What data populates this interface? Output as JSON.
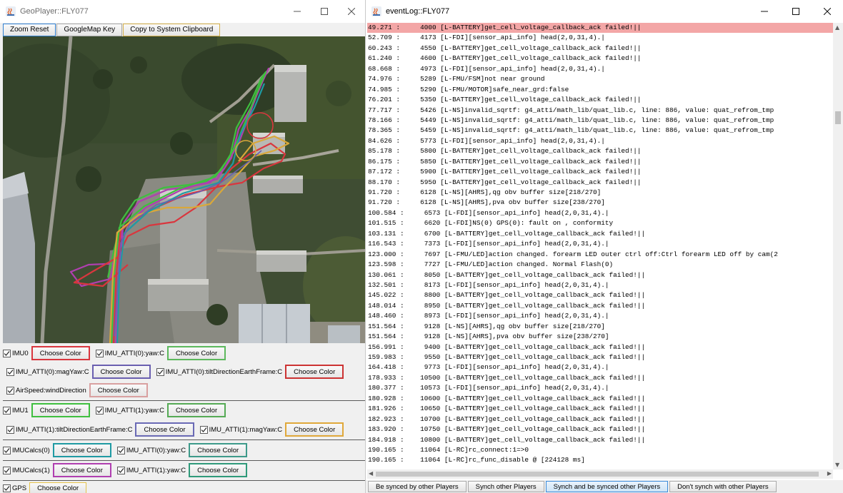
{
  "geo_window": {
    "title": "GeoPlayer::FLY077",
    "toolbar": {
      "zoom_reset": "Zoom Reset",
      "googlemap_key": "GoogleMap Key",
      "copy_clipboard": "Copy to System Clipboard"
    }
  },
  "legend": {
    "choose_color": "Choose Color",
    "items": [
      {
        "label": "IMU0",
        "color": "#d9363e"
      },
      {
        "label": "IMU_ATTI(0):yaw:C",
        "color": "#5cb85c"
      },
      {
        "label": "IMU_ATTI(0):magYaw:C",
        "color": "#6a5fb0"
      },
      {
        "label": "IMU_ATTI(0):tiltDirectionEarthFrame:C",
        "color": "#cc3333"
      },
      {
        "label": "AirSpeed:windDirection",
        "color": "#d9a0a0"
      },
      {
        "label": "IMU1",
        "color": "#3fbf3f"
      },
      {
        "label": "IMU_ATTI(1):yaw:C",
        "color": "#55aa55"
      },
      {
        "label": "IMU_ATTI(1):tiltDirectionEarthFrame:C",
        "color": "#6a6ab5"
      },
      {
        "label": "IMU_ATTI(1):magYaw:C",
        "color": "#e0a83a"
      },
      {
        "label": "IMUCalcs(0)",
        "color": "#1f9aa3"
      },
      {
        "label": "IMU_ATTI(0):yaw:C",
        "color": "#3d9a8a"
      },
      {
        "label": "IMUCalcs(1)",
        "color": "#b03fb0"
      },
      {
        "label": "IMU_ATTI(1):yaw:C",
        "color": "#2f9a7a"
      },
      {
        "label": "GPS",
        "color": "#e6c34a"
      }
    ]
  },
  "event_window": {
    "title": "eventLog::FLY077",
    "lines": [
      "49.271 :     4000 [L-BATTERY]get_cell_voltage_callback_ack failed!||",
      "52.709 :     4173 [L-FDI][sensor_api_info] head(2,0,31,4).|",
      "60.243 :     4550 [L-BATTERY]get_cell_voltage_callback_ack failed!||",
      "61.240 :     4600 [L-BATTERY]get_cell_voltage_callback_ack failed!||",
      "68.668 :     4973 [L-FDI][sensor_api_info] head(2,0,31,4).|",
      "74.976 :     5289 [L-FMU/FSM]not near ground",
      "74.985 :     5290 [L-FMU/MOTOR]safe_near_grd:false",
      "76.201 :     5350 [L-BATTERY]get_cell_voltage_callback_ack failed!||",
      "77.717 :     5426 [L-NS]invalid_sqrtf: g4_atti/math_lib/quat_lib.c, line: 886, value: quat_refrom_tmp",
      "78.166 :     5449 [L-NS]invalid_sqrtf: g4_atti/math_lib/quat_lib.c, line: 886, value: quat_refrom_tmp",
      "78.365 :     5459 [L-NS]invalid_sqrtf: g4_atti/math_lib/quat_lib.c, line: 886, value: quat_refrom_tmp",
      "84.626 :     5773 [L-FDI][sensor_api_info] head(2,0,31,4).|",
      "85.178 :     5800 [L-BATTERY]get_cell_voltage_callback_ack failed!||",
      "86.175 :     5850 [L-BATTERY]get_cell_voltage_callback_ack failed!||",
      "87.172 :     5900 [L-BATTERY]get_cell_voltage_callback_ack failed!||",
      "88.170 :     5950 [L-BATTERY]get_cell_voltage_callback_ack failed!||",
      "91.720 :     6128 [L-NS][AHRS],qg obv buffer size[218/270]",
      "91.720 :     6128 [L-NS][AHRS],pva obv buffer size[238/270]",
      "100.584 :     6573 [L-FDI][sensor_api_info] head(2,0,31,4).|",
      "101.515 :     6620 [L-FDI]NS(0) GPS(0): fault on , conformity",
      "103.131 :     6700 [L-BATTERY]get_cell_voltage_callback_ack failed!||",
      "116.543 :     7373 [L-FDI][sensor_api_info] head(2,0,31,4).|",
      "123.000 :     7697 [L-FMU/LED]action changed. forearm LED outer ctrl off:Ctrl forearm LED off by cam(2",
      "123.598 :     7727 [L-FMU/LED]action changed. Normal Flash(0)",
      "130.061 :     8050 [L-BATTERY]get_cell_voltage_callback_ack failed!||",
      "132.501 :     8173 [L-FDI][sensor_api_info] head(2,0,31,4).|",
      "145.022 :     8800 [L-BATTERY]get_cell_voltage_callback_ack failed!||",
      "148.014 :     8950 [L-BATTERY]get_cell_voltage_callback_ack failed!||",
      "148.460 :     8973 [L-FDI][sensor_api_info] head(2,0,31,4).|",
      "151.564 :     9128 [L-NS][AHRS],qg obv buffer size[218/270]",
      "151.564 :     9128 [L-NS][AHRS],pva obv buffer size[238/270]",
      "156.991 :     9400 [L-BATTERY]get_cell_voltage_callback_ack failed!||",
      "159.983 :     9550 [L-BATTERY]get_cell_voltage_callback_ack failed!||",
      "164.418 :     9773 [L-FDI][sensor_api_info] head(2,0,31,4).|",
      "178.933 :    10500 [L-BATTERY]get_cell_voltage_callback_ack failed!||",
      "180.377 :    10573 [L-FDI][sensor_api_info] head(2,0,31,4).|",
      "180.928 :    10600 [L-BATTERY]get_cell_voltage_callback_ack failed!||",
      "181.926 :    10650 [L-BATTERY]get_cell_voltage_callback_ack failed!||",
      "182.923 :    10700 [L-BATTERY]get_cell_voltage_callback_ack failed!||",
      "183.920 :    10750 [L-BATTERY]get_cell_voltage_callback_ack failed!||",
      "184.918 :    10800 [L-BATTERY]get_cell_voltage_callback_ack failed!||",
      "190.165 :    11064 [L-RC]rc_connect:1=>0",
      "190.165 :    11064 [L-RC]rc_func_disable @ [224128 ms]"
    ],
    "highlight_index": 0,
    "synch_buttons": {
      "be_synced": "Be synced by other Players",
      "synch_other": "Synch other Players",
      "synch_both": "Synch and be synced other Players",
      "dont_synch": "Don't synch with other Players"
    }
  }
}
